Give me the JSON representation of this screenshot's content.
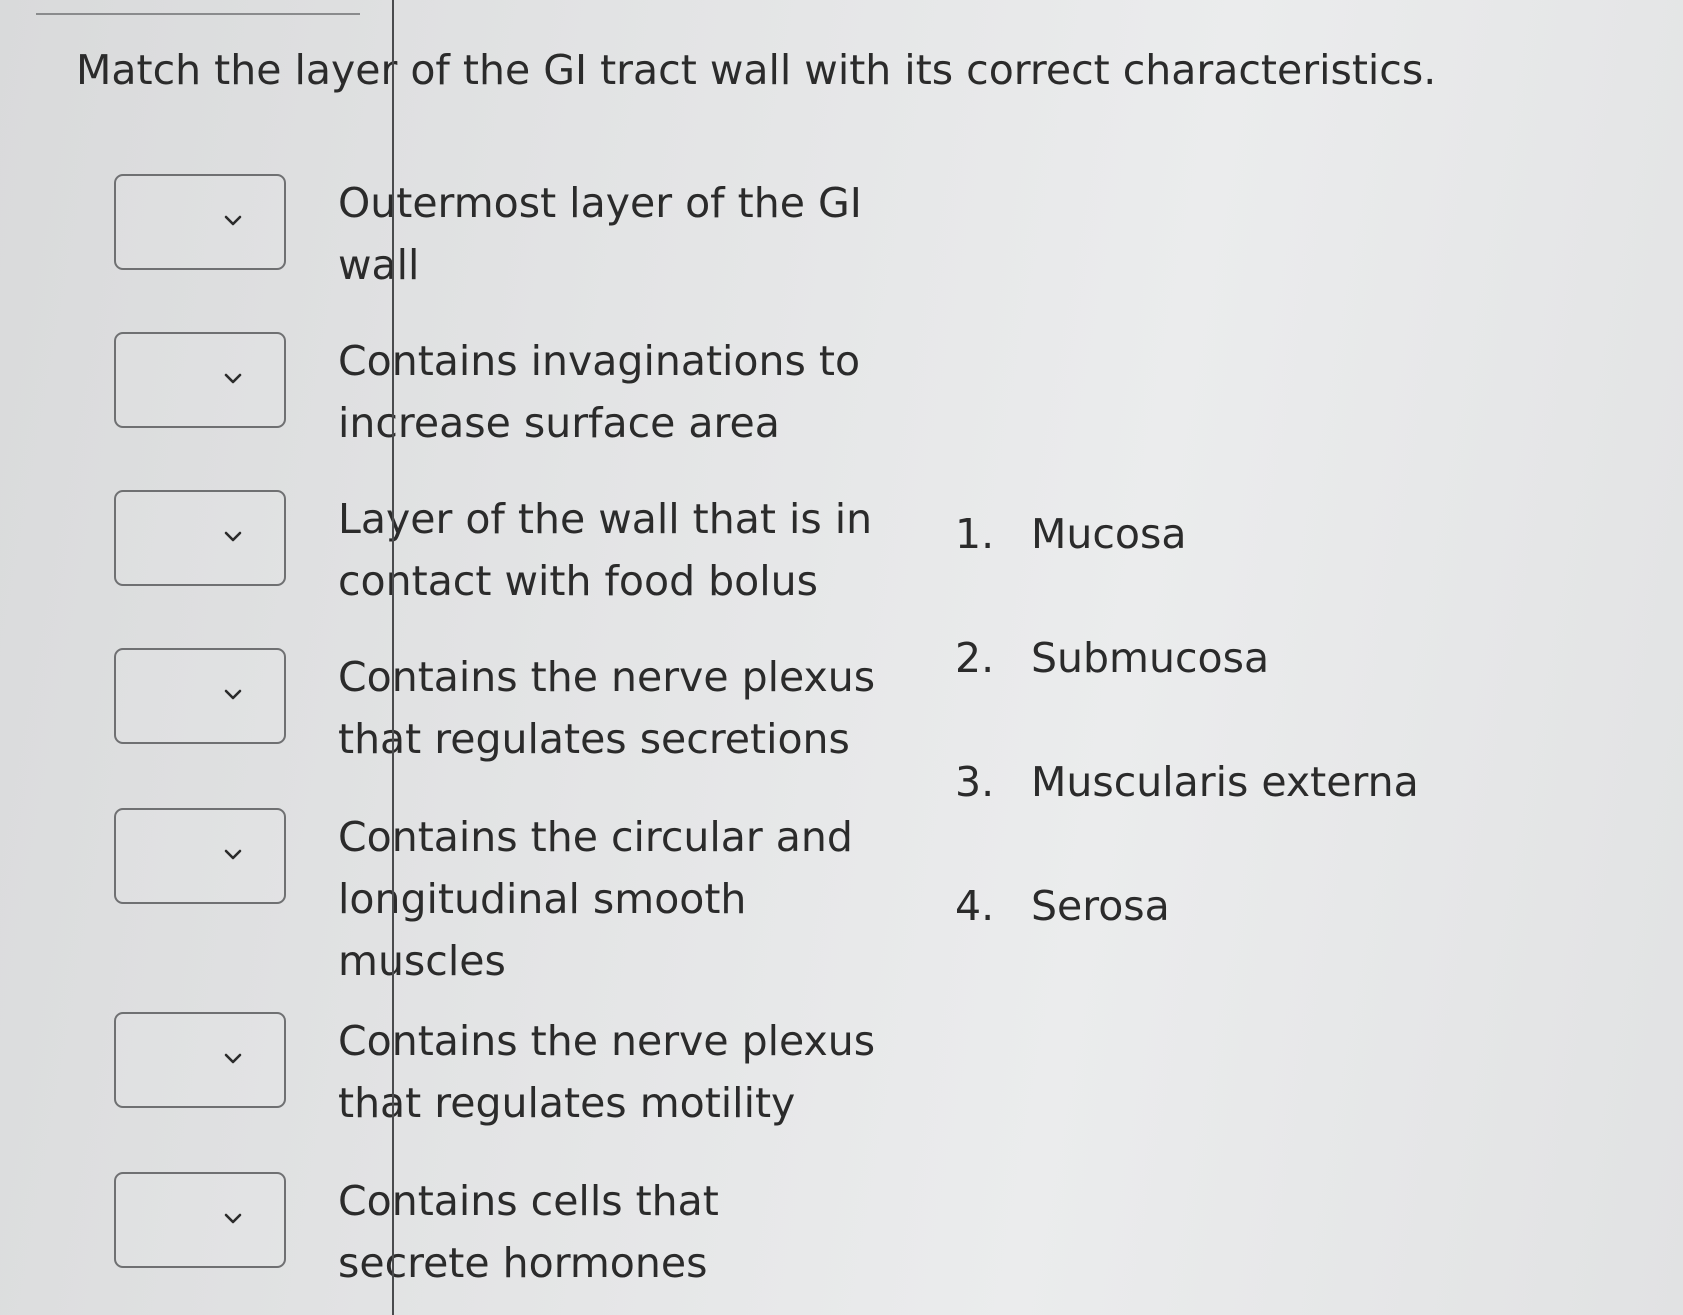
{
  "question": "Match the layer of the GI tract wall with its correct characteristics.",
  "prompts": [
    {
      "text": "Outermost layer of the GI wall",
      "selected": ""
    },
    {
      "text": "Contains invaginations to increase surface area",
      "selected": ""
    },
    {
      "text": "Layer of the wall that is in contact with food bolus",
      "selected": ""
    },
    {
      "text": "Contains the nerve plexus that regulates secretions",
      "selected": ""
    },
    {
      "text": "Contains the circular and longitudinal smooth muscles",
      "selected": ""
    },
    {
      "text": "Contains the nerve plexus that regulates motility",
      "selected": ""
    },
    {
      "text": "Contains cells that secrete hormones",
      "selected": ""
    }
  ],
  "options": [
    {
      "number": "1.",
      "label": "Mucosa"
    },
    {
      "number": "2.",
      "label": "Submucosa"
    },
    {
      "number": "3.",
      "label": "Muscularis externa"
    },
    {
      "number": "4.",
      "label": "Serosa"
    }
  ],
  "icons": {
    "dropdown": "chevron-down-icon"
  },
  "colors": {
    "text": "#2b2b2b",
    "border": "#6f7072"
  }
}
